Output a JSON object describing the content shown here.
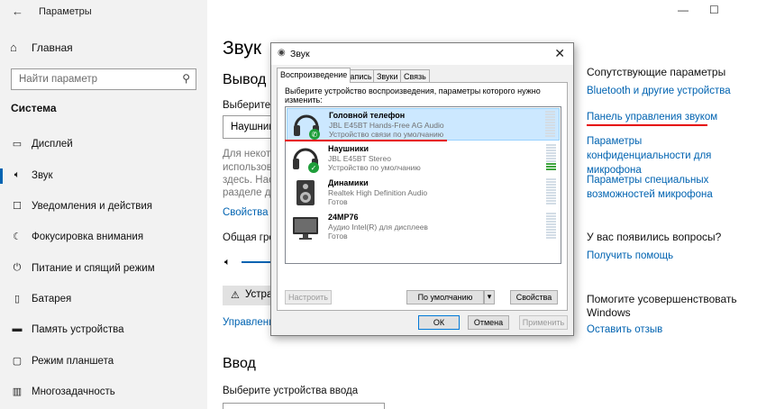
{
  "settings": {
    "window_title": "Параметры",
    "back_icon": "back-arrow-icon",
    "home_label": "Главная",
    "search_placeholder": "Найти параметр",
    "section_label": "Система",
    "nav": [
      {
        "label": "Дисплей",
        "icon": "display-icon"
      },
      {
        "label": "Звук",
        "icon": "speaker-icon"
      },
      {
        "label": "Уведомления и действия",
        "icon": "notifications-icon"
      },
      {
        "label": "Фокусировка внимания",
        "icon": "focus-assist-icon"
      },
      {
        "label": "Питание и спящий режим",
        "icon": "power-icon"
      },
      {
        "label": "Батарея",
        "icon": "battery-icon"
      },
      {
        "label": "Память устройства",
        "icon": "storage-icon"
      },
      {
        "label": "Режим планшета",
        "icon": "tablet-icon"
      },
      {
        "label": "Многозадачность",
        "icon": "multitasking-icon"
      }
    ],
    "main": {
      "title": "Звук",
      "output_heading": "Вывод",
      "output_device_label": "Выберите у",
      "output_device_value": "Наушник",
      "desc_lines": [
        "Для некото",
        "использова",
        "здесь. Наст",
        "разделе до"
      ],
      "device_props_link": "Свойства у",
      "volume_label": "Общая гро",
      "troubleshoot_label": "Устра",
      "manage_link": "Управлени",
      "input_heading": "Ввод",
      "input_label": "Выберите устройства ввода"
    },
    "related": {
      "heading": "Сопутствующие параметры",
      "links": [
        "Bluetooth и другие устройства",
        "Панель управления звуком",
        "Параметры конфиденциальности для микрофона",
        "Параметры специальных возможностей микрофона"
      ],
      "question_heading": "У вас появились вопросы?",
      "help_link": "Получить помощь",
      "improve_heading": "Помогите усовершенствовать Windows",
      "feedback_link": "Оставить отзыв"
    },
    "window_controls": {
      "minimize": "—",
      "maximize": "☐"
    }
  },
  "dialog": {
    "title": "Звук",
    "close": "✕",
    "tabs": [
      "Воспроизведение",
      "Запись",
      "Звуки",
      "Связь"
    ],
    "instruction": "Выберите устройство воспроизведения, параметры которого нужно изменить:",
    "devices": [
      {
        "name": "Головной телефон",
        "line2": "JBL E45BT Hands-Free AG Audio",
        "line3": "Устройство связи по умолчанию",
        "icon": "headset-icon",
        "badge": "phone-badge-icon",
        "meter_level": 0
      },
      {
        "name": "Наушники",
        "line2": "JBL E45BT Stereo",
        "line3": "Устройство по умолчанию",
        "icon": "headphones-icon",
        "badge": "check-badge-icon",
        "meter_level": 0.3
      },
      {
        "name": "Динамики",
        "line2": "Realtek High Definition Audio",
        "line3": "Готов",
        "icon": "speaker-device-icon",
        "badge": "",
        "meter_level": 0
      },
      {
        "name": "24MP76",
        "line2": "Аудио Intel(R) для дисплеев",
        "line3": "Готов",
        "icon": "monitor-icon",
        "badge": "",
        "meter_level": 0
      }
    ],
    "buttons": {
      "configure": "Настроить",
      "default": "По умолчанию",
      "properties": "Свойства",
      "ok": "ОК",
      "cancel": "Отмена",
      "apply": "Применить"
    }
  },
  "colors": {
    "accent": "#0063b1",
    "underline": "#e50000",
    "selected_row": "#cce8ff"
  }
}
